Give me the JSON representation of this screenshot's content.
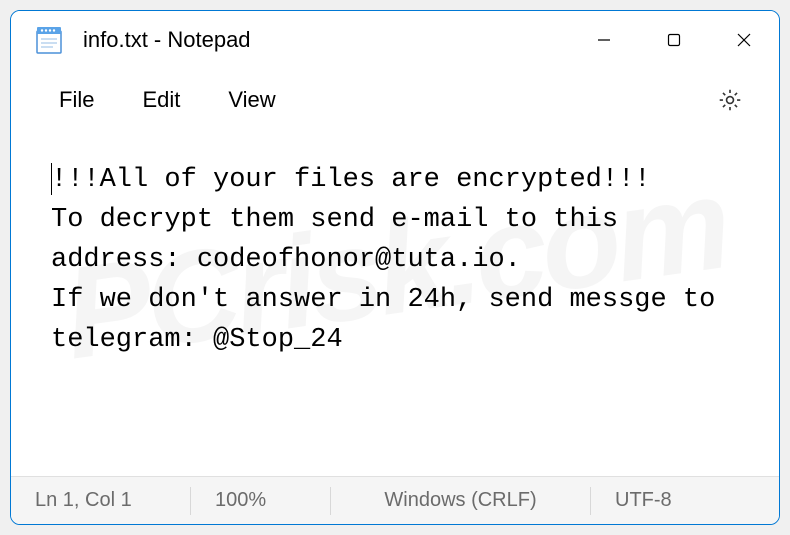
{
  "titlebar": {
    "title": "info.txt - Notepad"
  },
  "menubar": {
    "file": "File",
    "edit": "Edit",
    "view": "View"
  },
  "content": {
    "text": "!!!All of your files are encrypted!!!\nTo decrypt them send e-mail to this address: codeofhonor@tuta.io.\nIf we don't answer in 24h, send messge to telegram: @Stop_24"
  },
  "statusbar": {
    "position": "Ln 1, Col 1",
    "zoom": "100%",
    "line_ending": "Windows (CRLF)",
    "encoding": "UTF-8"
  },
  "watermark": "PCrisk.com"
}
